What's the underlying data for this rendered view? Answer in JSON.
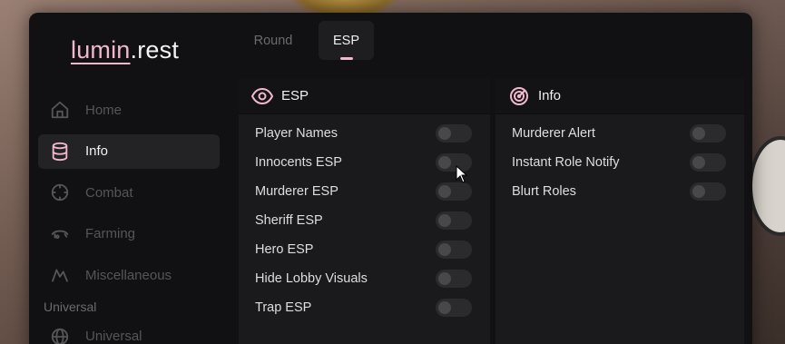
{
  "app": {
    "logo_accent": "lumin",
    "logo_rest": ".rest"
  },
  "tabs": [
    {
      "label": "Round",
      "active": false
    },
    {
      "label": "ESP",
      "active": true
    }
  ],
  "sidebar": {
    "items": [
      {
        "label": "Home",
        "icon": "home-icon",
        "active": false
      },
      {
        "label": "Info",
        "icon": "database-icon",
        "active": true
      },
      {
        "label": "Combat",
        "icon": "crosshair-icon",
        "active": false
      },
      {
        "label": "Farming",
        "icon": "farming-icon",
        "active": false
      },
      {
        "label": "Miscellaneous",
        "icon": "mountain-icon",
        "active": false
      }
    ],
    "section_label": "Universal",
    "section_items": [
      {
        "label": "Universal",
        "icon": "globe-icon",
        "active": false
      }
    ]
  },
  "panels": {
    "esp": {
      "title": "ESP",
      "icon": "eye-icon",
      "rows": [
        {
          "label": "Player Names",
          "enabled": false
        },
        {
          "label": "Innocents ESP",
          "enabled": false
        },
        {
          "label": "Murderer ESP",
          "enabled": false
        },
        {
          "label": "Sheriff ESP",
          "enabled": false
        },
        {
          "label": "Hero ESP",
          "enabled": false
        },
        {
          "label": "Hide Lobby Visuals",
          "enabled": false
        },
        {
          "label": "Trap ESP",
          "enabled": false
        }
      ]
    },
    "info": {
      "title": "Info",
      "icon": "radar-icon",
      "rows": [
        {
          "label": "Murderer Alert",
          "enabled": false
        },
        {
          "label": "Instant Role Notify",
          "enabled": false
        },
        {
          "label": "Blurt Roles",
          "enabled": false
        }
      ]
    }
  },
  "colors": {
    "accent": "#f1b8cc",
    "window_bg": "#111113",
    "active_item_bg": "#232326"
  }
}
